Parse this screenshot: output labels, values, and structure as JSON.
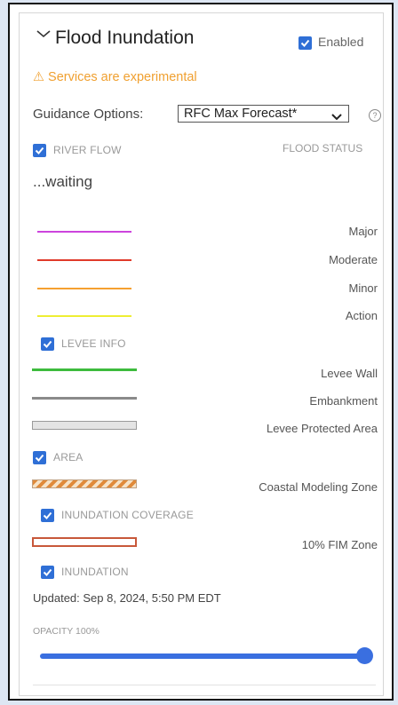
{
  "panel": {
    "title": "Flood Inundation",
    "enabled_label": "Enabled",
    "warning": "⚠ Services are experimental",
    "guidance_label": "Guidance Options:",
    "guidance_selected": "RFC Max Forecast*",
    "help_glyph": "?"
  },
  "sections": {
    "river_flow": "RIVER FLOW",
    "flood_status": "FLOOD STATUS",
    "waiting": "...waiting",
    "levee_info": "LEVEE INFO",
    "area": "AREA",
    "inundation_coverage": "INUNDATION COVERAGE",
    "inundation": "INUNDATION"
  },
  "flood_legend": [
    {
      "label": "Major",
      "color": "#cc44dd"
    },
    {
      "label": "Moderate",
      "color": "#e03a2a"
    },
    {
      "label": "Minor",
      "color": "#f5a030"
    },
    {
      "label": "Action",
      "color": "#eeee33"
    }
  ],
  "levee_legend": [
    {
      "label": "Levee Wall",
      "color": "#3dbb3d"
    },
    {
      "label": "Embankment",
      "color": "#8a8a8a"
    },
    {
      "label": "Levee Protected Area",
      "color": "#9a9a9a"
    }
  ],
  "area_legend": [
    {
      "label": "Coastal Modeling Zone",
      "color": "#e08a3a"
    }
  ],
  "coverage_legend": [
    {
      "label": "10% FIM Zone",
      "color": "#c8583a"
    }
  ],
  "updated": "Updated: Sep 8, 2024, 5:50 PM EDT",
  "opacity_label": "OPACITY 100%",
  "opacity_value": 100,
  "accent_color": "#2f6fd6"
}
